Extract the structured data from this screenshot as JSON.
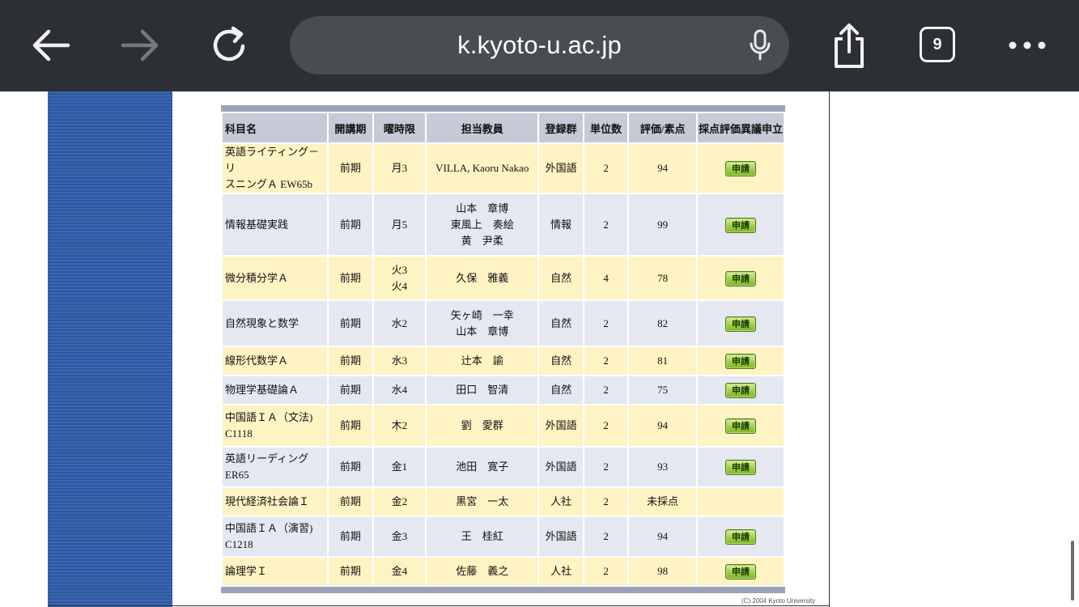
{
  "browser": {
    "url": "k.kyoto-u.ac.jp",
    "tab_count": "9"
  },
  "table": {
    "headers": [
      "科目名",
      "開講期",
      "曜時限",
      "担当教員",
      "登録群",
      "単位数",
      "評価/素点",
      "採点評価異議申立"
    ],
    "apply_label": "申請",
    "rows": [
      {
        "subject": [
          "英語ライティング－リ",
          "スニングＡ EW65b"
        ],
        "term": "前期",
        "period": [
          "月3"
        ],
        "teacher": [
          "VILLA, Kaoru Nakao"
        ],
        "group": "外国語",
        "credits": "2",
        "grade": "94",
        "apply": true
      },
      {
        "subject": [
          "情報基礎実践"
        ],
        "term": "前期",
        "period": [
          "月5"
        ],
        "teacher": [
          "山本　章博",
          "東風上　奏絵",
          "黄　尹柔"
        ],
        "group": "情報",
        "credits": "2",
        "grade": "99",
        "apply": true
      },
      {
        "subject": [
          "微分積分学Ａ"
        ],
        "term": "前期",
        "period": [
          "火3",
          "火4"
        ],
        "teacher": [
          "久保　雅義"
        ],
        "group": "自然",
        "credits": "4",
        "grade": "78",
        "apply": true
      },
      {
        "subject": [
          "自然現象と数学"
        ],
        "term": "前期",
        "period": [
          "水2"
        ],
        "teacher": [
          "矢ヶ崎　一幸",
          "山本　章博"
        ],
        "group": "自然",
        "credits": "2",
        "grade": "82",
        "apply": true
      },
      {
        "subject": [
          "線形代数学Ａ"
        ],
        "term": "前期",
        "period": [
          "水3"
        ],
        "teacher": [
          "辻本　諭"
        ],
        "group": "自然",
        "credits": "2",
        "grade": "81",
        "apply": true
      },
      {
        "subject": [
          "物理学基礎論Ａ"
        ],
        "term": "前期",
        "period": [
          "水4"
        ],
        "teacher": [
          "田口　智清"
        ],
        "group": "自然",
        "credits": "2",
        "grade": "75",
        "apply": true
      },
      {
        "subject": [
          "中国語ＩＡ（文法)",
          "C1118"
        ],
        "term": "前期",
        "period": [
          "木2"
        ],
        "teacher": [
          "劉　愛群"
        ],
        "group": "外国語",
        "credits": "2",
        "grade": "94",
        "apply": true
      },
      {
        "subject": [
          "英語リーディング",
          "ER65"
        ],
        "term": "前期",
        "period": [
          "金1"
        ],
        "teacher": [
          "池田　寛子"
        ],
        "group": "外国語",
        "credits": "2",
        "grade": "93",
        "apply": true
      },
      {
        "subject": [
          "現代経済社会論Ｉ"
        ],
        "term": "前期",
        "period": [
          "金2"
        ],
        "teacher": [
          "黒宮　一太"
        ],
        "group": "人社",
        "credits": "2",
        "grade": "未採点",
        "apply": false
      },
      {
        "subject": [
          "中国語ＩＡ（演習)",
          "C1218"
        ],
        "term": "前期",
        "period": [
          "金3"
        ],
        "teacher": [
          "王　桂紅"
        ],
        "group": "外国語",
        "credits": "2",
        "grade": "94",
        "apply": true
      },
      {
        "subject": [
          "論理学Ｉ"
        ],
        "term": "前期",
        "period": [
          "金4"
        ],
        "teacher": [
          "佐藤　義之"
        ],
        "group": "人社",
        "credits": "2",
        "grade": "98",
        "apply": true
      }
    ]
  },
  "footer": {
    "copyright": "(C) 2004 Kyoto University"
  },
  "colors": {
    "row_yellow": "#fdf3c3",
    "row_blue": "#e5e8f1",
    "header": "#c8c9d6",
    "sidebar": "#3a66b0",
    "toolbar": "#2c2f33"
  }
}
